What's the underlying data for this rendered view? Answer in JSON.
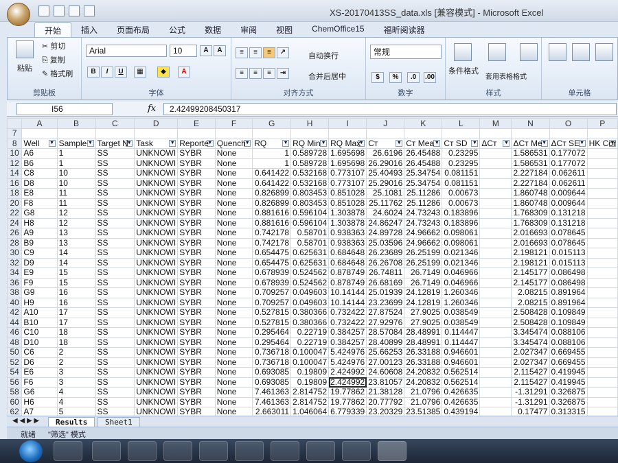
{
  "window": {
    "title": "XS-20170413SS_data.xls  [兼容模式]  -  Microsoft Excel"
  },
  "ribbon_tabs": [
    "开始",
    "插入",
    "页面布局",
    "公式",
    "数据",
    "审阅",
    "视图",
    "ChemOffice15",
    "福昕阅读器"
  ],
  "clipboard": {
    "paste": "粘贴",
    "cut": "剪切",
    "copy": "复制",
    "format_painter": "格式刷",
    "label": "剪贴板"
  },
  "font": {
    "name": "Arial",
    "size": "10",
    "label": "字体",
    "bold": "B",
    "italic": "I",
    "underline": "U"
  },
  "alignment": {
    "wrap": "自动换行",
    "merge": "合并后居中",
    "label": "对齐方式"
  },
  "number": {
    "format": "常规",
    "percent": "%",
    "label": "数字"
  },
  "styles": {
    "conditional": "条件格式",
    "table_format": "套用表格格式",
    "cell_styles": "样式",
    "label": "样式"
  },
  "cells": {
    "label": "单元格"
  },
  "formula_bar": {
    "cell_ref": "I56",
    "fx": "fx",
    "value": "2.42499208450317"
  },
  "columns": [
    "",
    "A",
    "B",
    "C",
    "D",
    "E",
    "F",
    "G",
    "H",
    "I",
    "J",
    "K",
    "L",
    "M",
    "N",
    "O",
    "P"
  ],
  "header_row": {
    "row": "8",
    "cells": [
      "Well",
      "Sample",
      "Target N",
      "Task",
      "Reporte",
      "Quench",
      "RQ",
      "RQ Min",
      "RQ Max",
      "Cт",
      "Cт Mea",
      "Cт SD",
      "ΔCт",
      "ΔCт Me",
      "ΔCт SE",
      "HK Cor"
    ]
  },
  "rows": [
    [
      "7",
      "",
      "",
      "",
      "",
      "",
      "",
      "",
      "",
      "",
      "",
      "",
      "",
      "",
      "",
      "",
      ""
    ],
    [
      "10",
      "A6",
      "1",
      "SS",
      "UNKNOWI",
      "SYBR",
      "None",
      "1",
      "0.589728",
      "1.695698",
      "26.6196",
      "26.45488",
      "0.23295",
      "",
      "1.586531",
      "0.177072",
      ""
    ],
    [
      "12",
      "B6",
      "1",
      "SS",
      "UNKNOWI",
      "SYBR",
      "None",
      "1",
      "0.589728",
      "1.695698",
      "26.29016",
      "26.45488",
      "0.23295",
      "",
      "1.586531",
      "0.177072",
      ""
    ],
    [
      "14",
      "C8",
      "10",
      "SS",
      "UNKNOWI",
      "SYBR",
      "None",
      "0.641422",
      "0.532168",
      "0.773107",
      "25.40493",
      "25.34754",
      "0.081151",
      "",
      "2.227184",
      "0.062611",
      ""
    ],
    [
      "16",
      "D8",
      "10",
      "SS",
      "UNKNOWI",
      "SYBR",
      "None",
      "0.641422",
      "0.532168",
      "0.773107",
      "25.29016",
      "25.34754",
      "0.081151",
      "",
      "2.227184",
      "0.062611",
      ""
    ],
    [
      "18",
      "E8",
      "11",
      "SS",
      "UNKNOWI",
      "SYBR",
      "None",
      "0.826899",
      "0.803453",
      "0.851028",
      "25.1081",
      "25.11286",
      "0.00673",
      "",
      "1.860748",
      "0.009644",
      ""
    ],
    [
      "20",
      "F8",
      "11",
      "SS",
      "UNKNOWI",
      "SYBR",
      "None",
      "0.826899",
      "0.803453",
      "0.851028",
      "25.11762",
      "25.11286",
      "0.00673",
      "",
      "1.860748",
      "0.009644",
      ""
    ],
    [
      "22",
      "G8",
      "12",
      "SS",
      "UNKNOWI",
      "SYBR",
      "None",
      "0.881616",
      "0.596104",
      "1.303878",
      "24.6024",
      "24.73243",
      "0.183896",
      "",
      "1.768309",
      "0.131218",
      ""
    ],
    [
      "24",
      "H8",
      "12",
      "SS",
      "UNKNOWI",
      "SYBR",
      "None",
      "0.881616",
      "0.596104",
      "1.303878",
      "24.86247",
      "24.73243",
      "0.183896",
      "",
      "1.768309",
      "0.131218",
      ""
    ],
    [
      "26",
      "A9",
      "13",
      "SS",
      "UNKNOWI",
      "SYBR",
      "None",
      "0.742178",
      "0.58701",
      "0.938363",
      "24.89728",
      "24.96662",
      "0.098061",
      "",
      "2.016693",
      "0.078645",
      ""
    ],
    [
      "28",
      "B9",
      "13",
      "SS",
      "UNKNOWI",
      "SYBR",
      "None",
      "0.742178",
      "0.58701",
      "0.938363",
      "25.03596",
      "24.96662",
      "0.098061",
      "",
      "2.016693",
      "0.078645",
      ""
    ],
    [
      "30",
      "C9",
      "14",
      "SS",
      "UNKNOWI",
      "SYBR",
      "None",
      "0.654475",
      "0.625631",
      "0.684648",
      "26.23689",
      "26.25199",
      "0.021346",
      "",
      "2.198121",
      "0.015113",
      ""
    ],
    [
      "32",
      "D9",
      "14",
      "SS",
      "UNKNOWI",
      "SYBR",
      "None",
      "0.654475",
      "0.625631",
      "0.684648",
      "26.26708",
      "26.25199",
      "0.021346",
      "",
      "2.198121",
      "0.015113",
      ""
    ],
    [
      "34",
      "E9",
      "15",
      "SS",
      "UNKNOWI",
      "SYBR",
      "None",
      "0.678939",
      "0.524562",
      "0.878749",
      "26.74811",
      "26.7149",
      "0.046966",
      "",
      "2.145177",
      "0.086498",
      ""
    ],
    [
      "36",
      "F9",
      "15",
      "SS",
      "UNKNOWI",
      "SYBR",
      "None",
      "0.678939",
      "0.524562",
      "0.878749",
      "26.68169",
      "26.7149",
      "0.046966",
      "",
      "2.145177",
      "0.086498",
      ""
    ],
    [
      "38",
      "G9",
      "16",
      "SS",
      "UNKNOWI",
      "SYBR",
      "None",
      "0.709257",
      "0.049603",
      "10.14144",
      "25.01939",
      "24.12819",
      "1.260346",
      "",
      "2.08215",
      "0.891964",
      ""
    ],
    [
      "40",
      "H9",
      "16",
      "SS",
      "UNKNOWI",
      "SYBR",
      "None",
      "0.709257",
      "0.049603",
      "10.14144",
      "23.23699",
      "24.12819",
      "1.260346",
      "",
      "2.08215",
      "0.891964",
      ""
    ],
    [
      "42",
      "A10",
      "17",
      "SS",
      "UNKNOWI",
      "SYBR",
      "None",
      "0.527815",
      "0.380366",
      "0.732422",
      "27.87524",
      "27.9025",
      "0.038549",
      "",
      "2.508428",
      "0.109849",
      ""
    ],
    [
      "44",
      "B10",
      "17",
      "SS",
      "UNKNOWI",
      "SYBR",
      "None",
      "0.527815",
      "0.380366",
      "0.732422",
      "27.92976",
      "27.9025",
      "0.038549",
      "",
      "2.508428",
      "0.109849",
      ""
    ],
    [
      "46",
      "C10",
      "18",
      "SS",
      "UNKNOWI",
      "SYBR",
      "None",
      "0.295464",
      "0.22719",
      "0.384257",
      "28.57084",
      "28.48991",
      "0.114447",
      "",
      "3.345474",
      "0.088106",
      ""
    ],
    [
      "48",
      "D10",
      "18",
      "SS",
      "UNKNOWI",
      "SYBR",
      "None",
      "0.295464",
      "0.22719",
      "0.384257",
      "28.40899",
      "28.48991",
      "0.114447",
      "",
      "3.345474",
      "0.088106",
      ""
    ],
    [
      "50",
      "C6",
      "2",
      "SS",
      "UNKNOWI",
      "SYBR",
      "None",
      "0.736718",
      "0.100047",
      "5.424976",
      "25.66253",
      "26.33188",
      "0.946601",
      "",
      "2.027347",
      "0.669455",
      ""
    ],
    [
      "52",
      "D6",
      "2",
      "SS",
      "UNKNOWI",
      "SYBR",
      "None",
      "0.736718",
      "0.100047",
      "5.424976",
      "27.00123",
      "26.33188",
      "0.946601",
      "",
      "2.027347",
      "0.669455",
      ""
    ],
    [
      "54",
      "E6",
      "3",
      "SS",
      "UNKNOWI",
      "SYBR",
      "None",
      "0.693085",
      "0.19809",
      "2.424992",
      "24.60608",
      "24.20832",
      "0.562514",
      "",
      "2.115427",
      "0.419945",
      ""
    ],
    [
      "56",
      "F6",
      "3",
      "SS",
      "UNKNOWI",
      "SYBR",
      "None",
      "0.693085",
      "0.19809",
      "2.424992",
      "23.81057",
      "24.20832",
      "0.562514",
      "",
      "2.115427",
      "0.419945",
      ""
    ],
    [
      "58",
      "G6",
      "4",
      "SS",
      "UNKNOWI",
      "SYBR",
      "None",
      "7.461363",
      "2.814752",
      "19.77862",
      "21.38128",
      "21.0796",
      "0.426635",
      "",
      "-1.31291",
      "0.326875",
      ""
    ],
    [
      "60",
      "H6",
      "4",
      "SS",
      "UNKNOWI",
      "SYBR",
      "None",
      "7.461363",
      "2.814752",
      "19.77862",
      "20.77792",
      "21.0796",
      "0.426635",
      "",
      "-1.31291",
      "0.326875",
      ""
    ],
    [
      "62",
      "A7",
      "5",
      "SS",
      "UNKNOWI",
      "SYBR",
      "None",
      "2.663011",
      "1.046064",
      "6.779339",
      "23.20329",
      "23.51385",
      "0.439194",
      "",
      "0.17477",
      "0.313315",
      ""
    ]
  ],
  "sheets": {
    "active": "Results",
    "other": "Sheet1"
  },
  "status": {
    "ready": "就绪",
    "filter_mode": "\"筛选\" 模式"
  }
}
